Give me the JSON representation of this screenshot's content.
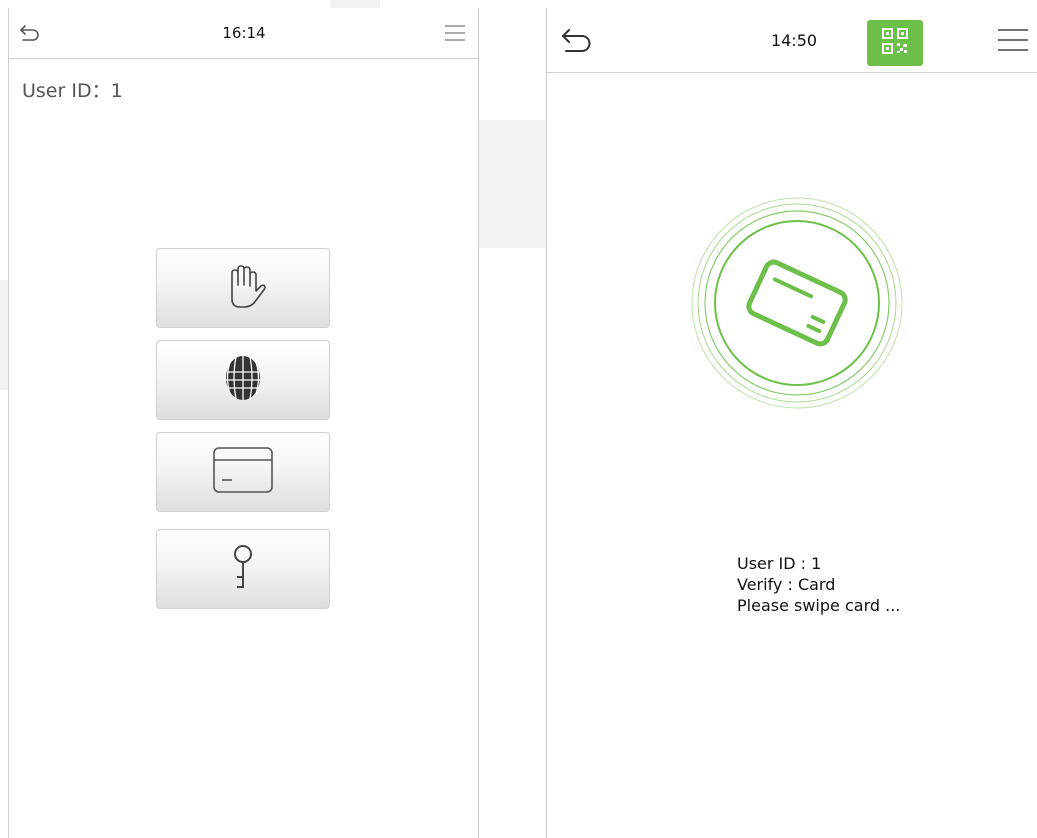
{
  "left_screen": {
    "clock": "16:14",
    "user_id_label": "User ID：",
    "user_id_value": "1",
    "icons": {
      "back": "back-arrow-icon",
      "menu": "menu-icon"
    },
    "verify_options": [
      {
        "name": "palm",
        "icon": "palm-icon"
      },
      {
        "name": "face",
        "icon": "face-icon"
      },
      {
        "name": "card",
        "icon": "card-icon"
      },
      {
        "name": "password",
        "icon": "key-icon"
      }
    ]
  },
  "right_screen": {
    "clock": "14:50",
    "icons": {
      "back": "back-arrow-icon",
      "qr": "qr-code-icon",
      "menu": "menu-icon",
      "card": "card-swipe-icon"
    },
    "info": {
      "user_id": "User ID : 1",
      "verify": "Verify : Card",
      "prompt": "Please swipe card ..."
    }
  },
  "colors": {
    "accent_green": "#6cc04a",
    "border": "#cfcfcf",
    "icon_gray": "#555555"
  }
}
